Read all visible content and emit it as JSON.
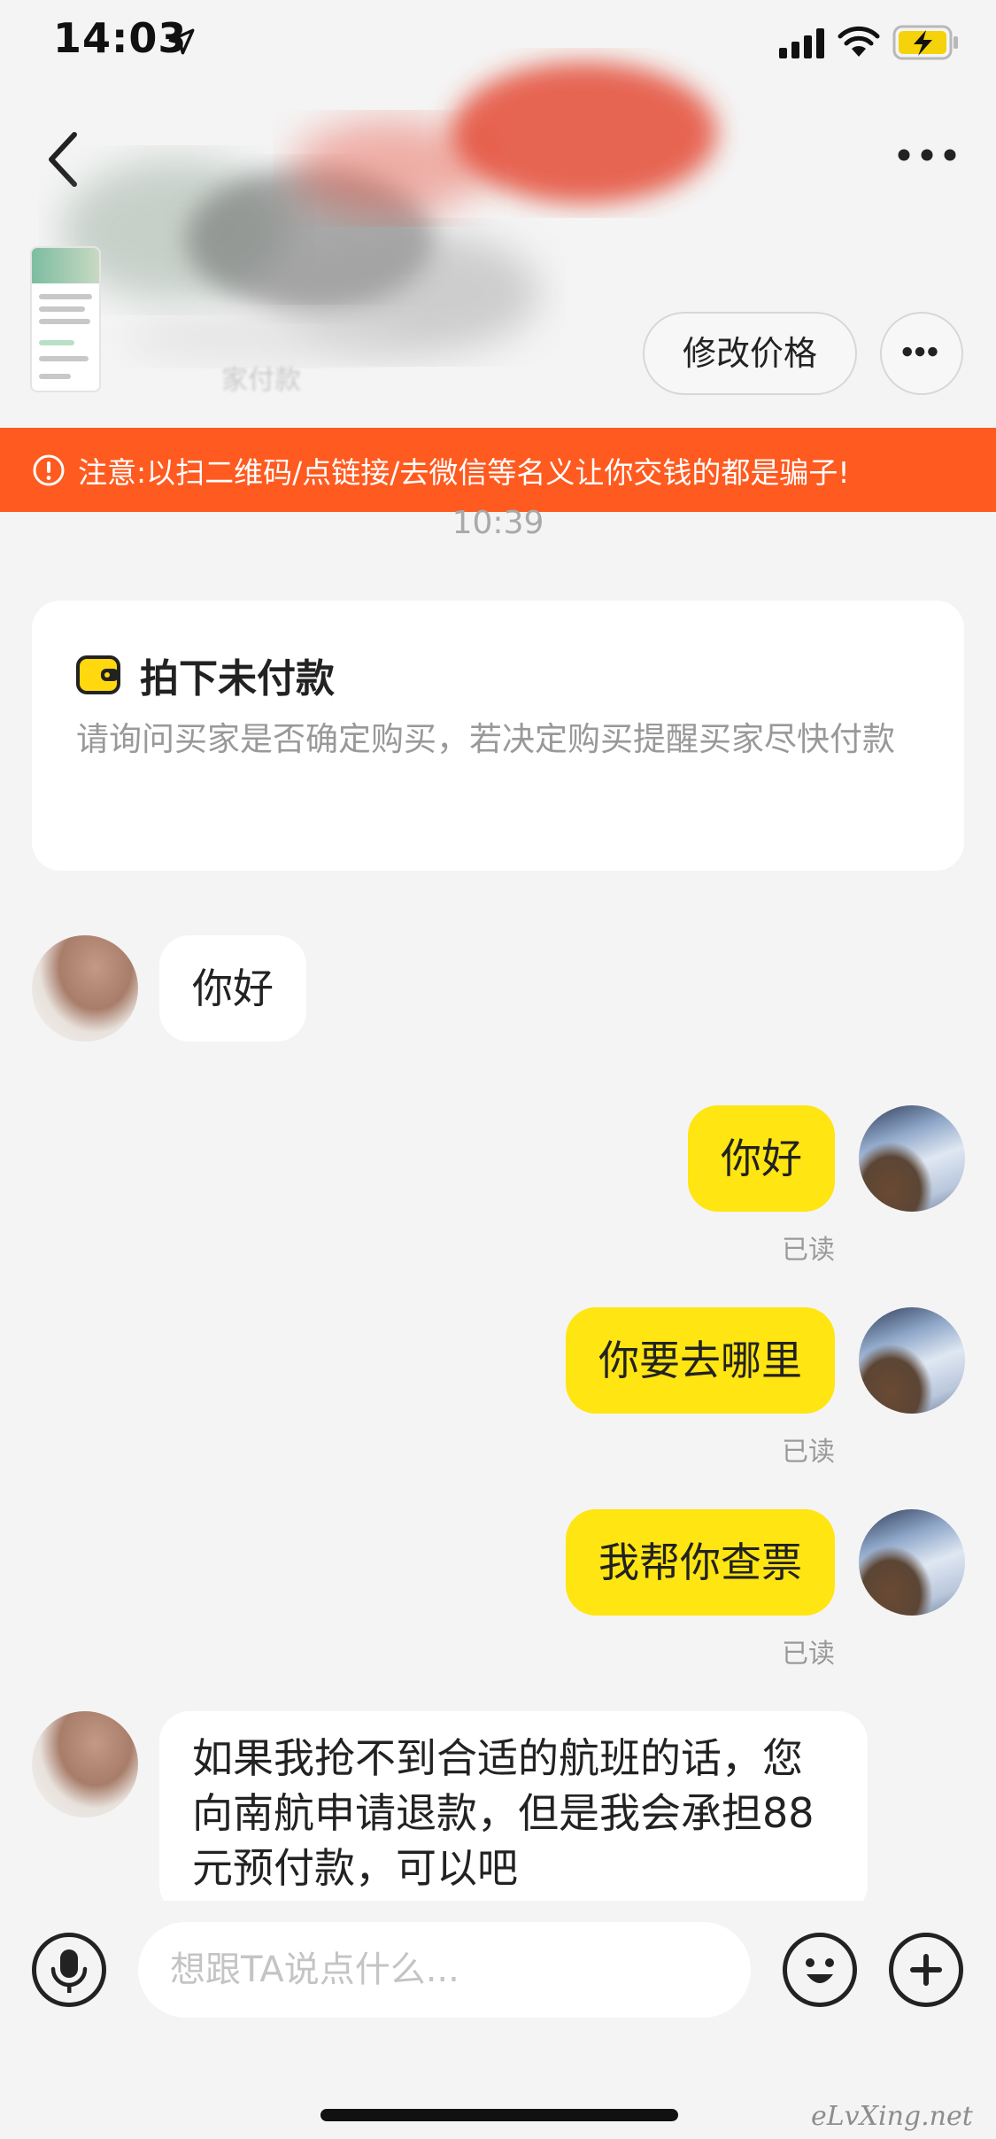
{
  "status_bar": {
    "time": "14:03",
    "icons": [
      "location-arrow-icon",
      "signal-icon",
      "wifi-icon",
      "battery-charging-icon"
    ],
    "battery_color": "#f5d20a"
  },
  "header": {
    "icons": [
      "back-chevron-icon",
      "more-dots-icon"
    ]
  },
  "product_card": {
    "edit_price_label": "修改价格",
    "obscured_status_text": "家付款"
  },
  "warning": {
    "text": "注意:以扫二维码/点链接/去微信等名义让你交钱的都是骗子!",
    "color": "#ff5a1f"
  },
  "timestamp": "10:39",
  "order_card": {
    "icon": "wallet-icon",
    "title": "拍下未付款",
    "description": "请询问买家是否确定购买，若决定购买提醒买家尽快付款"
  },
  "messages": [
    {
      "sender": "other",
      "text": "你好"
    },
    {
      "sender": "self",
      "text": "你好",
      "status": "已读"
    },
    {
      "sender": "self",
      "text": "你要去哪里",
      "status": "已读"
    },
    {
      "sender": "self",
      "text": "我帮你查票",
      "status": "已读"
    },
    {
      "sender": "other",
      "text": "如果我抢不到合适的航班的话，您向南航申请退款，但是我会承担88元预付款，可以吧"
    }
  ],
  "input_bar": {
    "placeholder": "想跟TA说点什么...",
    "icons": [
      "microphone-icon",
      "emoji-icon",
      "plus-icon"
    ]
  },
  "colors": {
    "bubble_self": "#ffe511",
    "bubble_other": "#ffffff",
    "background": "#f4f4f4"
  },
  "watermark": "eLvXing.net"
}
